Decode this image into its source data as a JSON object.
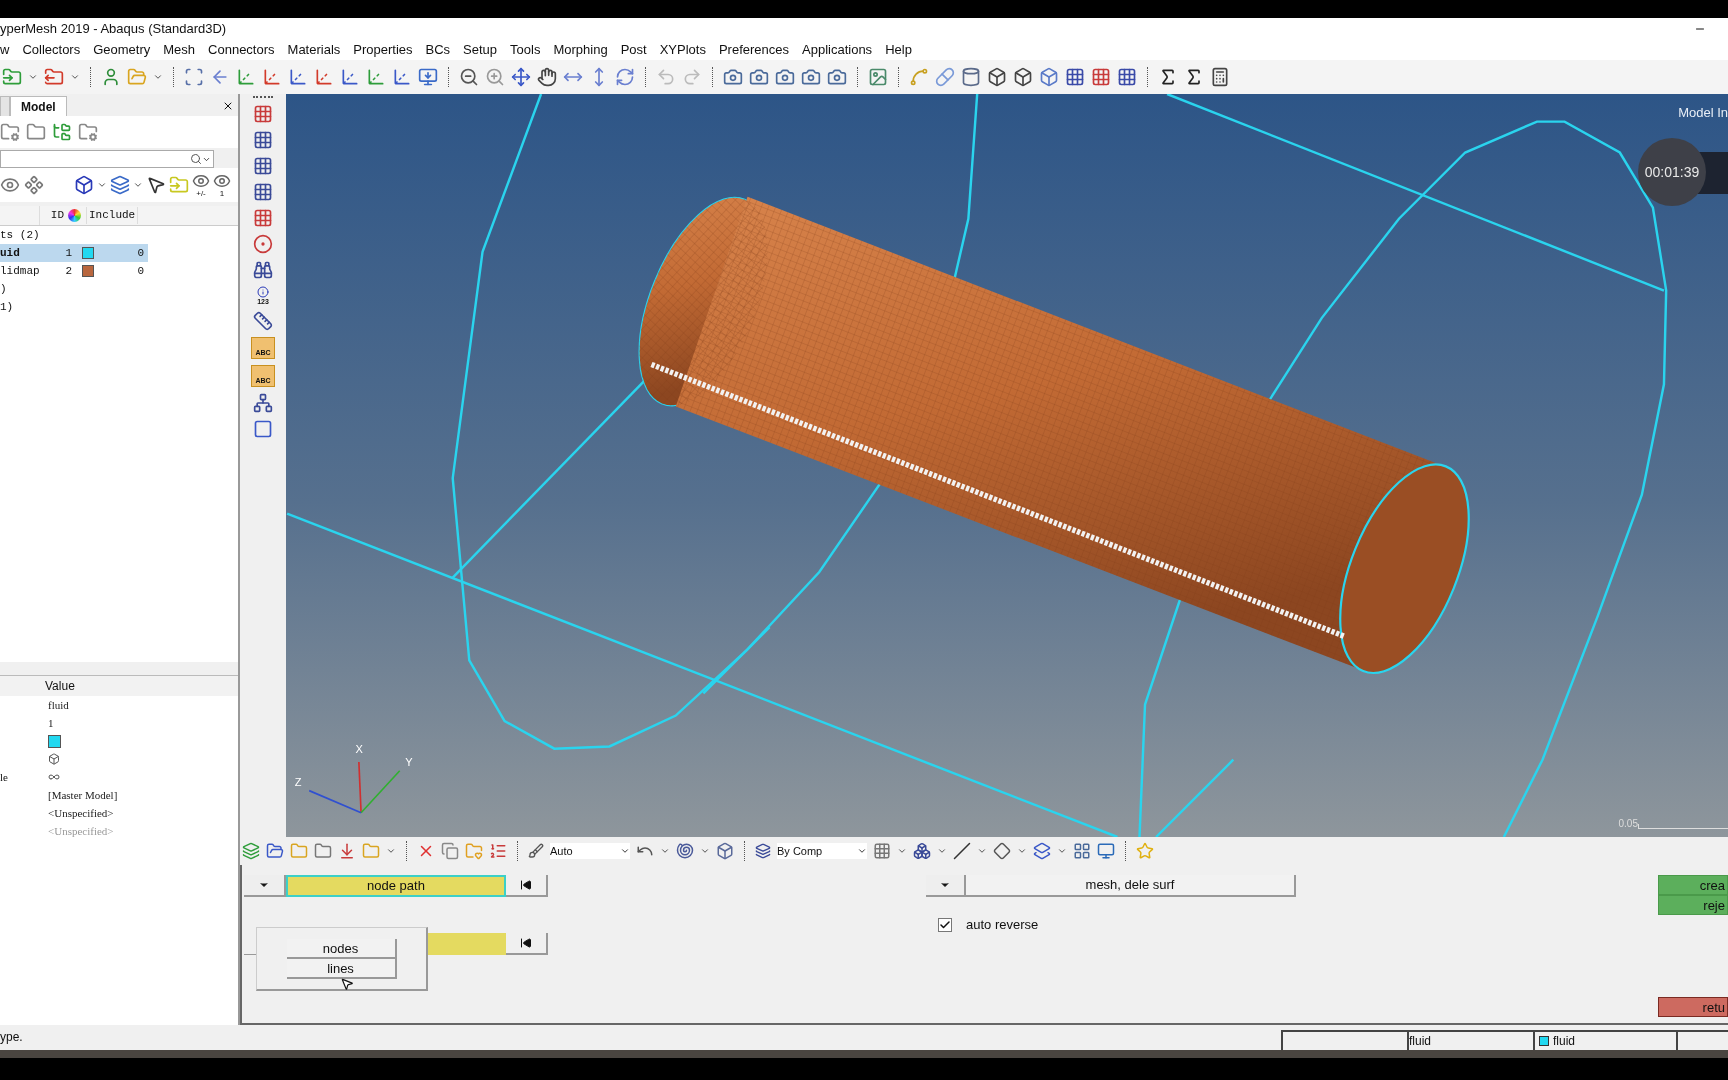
{
  "window": {
    "title": "yperMesh 2019 - Abaqus (Standard3D)"
  },
  "menu": [
    "w",
    "Collectors",
    "Geometry",
    "Mesh",
    "Connectors",
    "Materials",
    "Properties",
    "BCs",
    "Setup",
    "Tools",
    "Morphing",
    "Post",
    "XYPlots",
    "Preferences",
    "Applications",
    "Help"
  ],
  "left_panel": {
    "tabs": [
      {
        "label": "Model",
        "selected": true
      }
    ],
    "eye_labels": [
      "+/-",
      "1"
    ],
    "tree": {
      "columns": [
        "ID",
        "Include"
      ],
      "rows": [
        {
          "name": "ts (2)",
          "expanded": true,
          "children": [
            {
              "name": "uid",
              "id": "1",
              "color": "#22d8f0",
              "include": "0",
              "selected": true
            },
            {
              "name": "lidmap",
              "id": "2",
              "color": "#b8663e",
              "include": "0",
              "selected": false
            }
          ]
        },
        {
          "name": ")"
        },
        {
          "name": "1)"
        }
      ]
    },
    "properties": {
      "header": "Value",
      "rows": [
        {
          "kind": "text",
          "value": "fluid",
          "disabled": false
        },
        {
          "kind": "text",
          "value": "1",
          "disabled": false
        },
        {
          "kind": "swatch",
          "color": "#22d8f0"
        },
        {
          "kind": "icon"
        },
        {
          "kind": "icon",
          "label": "le"
        },
        {
          "kind": "text",
          "value": "[Master Model]",
          "disabled": false
        },
        {
          "kind": "text",
          "value": "<Unspecified>",
          "disabled": false
        },
        {
          "kind": "text",
          "value": "<Unspecified>",
          "disabled": true
        }
      ]
    }
  },
  "vertical_toolbar": {
    "info_label": "123",
    "text_labels": [
      "ABC",
      "ABC"
    ]
  },
  "viewport": {
    "model_info": "Model In",
    "timer": "00:01:39",
    "scale_label": "0.05",
    "axes": [
      "X",
      "Y",
      "Z"
    ]
  },
  "bottom_toolbar": {
    "display_mode": "Auto",
    "color_mode": "By Comp"
  },
  "panel": {
    "node_path": "node path",
    "popup": [
      "nodes",
      "lines"
    ],
    "surface_mode": "mesh, dele surf",
    "auto_reverse": {
      "label": "auto reverse",
      "checked": true
    },
    "buttons": [
      {
        "label": "crea",
        "kind": "accept"
      },
      {
        "label": "reje",
        "kind": "accept"
      },
      {
        "label": "retu",
        "kind": "return"
      }
    ]
  },
  "status_bar": {
    "message": "ype.",
    "fields": [
      {
        "text": "fluid"
      },
      {
        "text": "fluid",
        "color": "#22d8f0"
      }
    ]
  }
}
